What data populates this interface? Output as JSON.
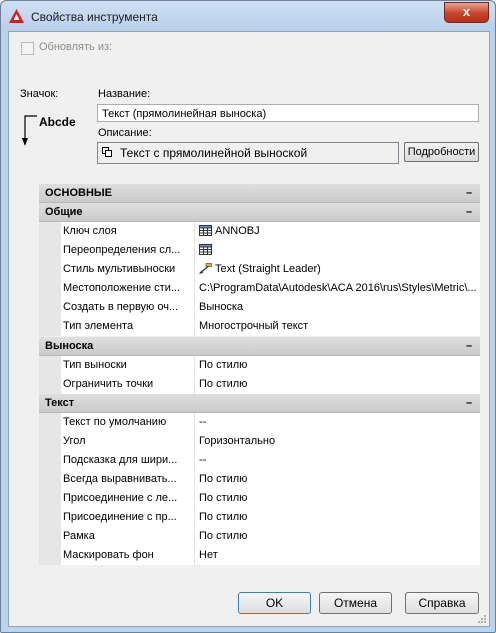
{
  "window": {
    "title": "Свойства инструмента",
    "close_label": "x"
  },
  "top": {
    "refresh_from_label": "Обновлять из:",
    "icon_label": "Значок:",
    "name_label": "Название:",
    "name_value": "Текст (прямолинейная выноска)",
    "description_label": "Описание:",
    "description_value": "Текст с прямолинейной выноской",
    "details_button": "Подробности",
    "preview_text": "Abcde"
  },
  "grid": {
    "main_header": "ОСНОВНЫЕ",
    "groups": {
      "general": {
        "title": "Общие",
        "rows": [
          {
            "name": "Ключ слоя",
            "value": "ANNOBJ",
            "icon": "table-icon"
          },
          {
            "name": "Переопределения сл...",
            "value": "",
            "icon": "table-icon"
          },
          {
            "name": "Стиль мультивыноски",
            "value": "Text (Straight Leader)",
            "icon": "leader-style-icon"
          },
          {
            "name": "Местоположение сти...",
            "value": "C:\\ProgramData\\Autodesk\\ACA 2016\\rus\\Styles\\Metric\\..."
          },
          {
            "name": "Создать в первую оч...",
            "value": "Выноска"
          },
          {
            "name": "Тип элемента",
            "value": "Многострочный текст"
          }
        ]
      },
      "leader": {
        "title": "Выноска",
        "rows": [
          {
            "name": "Тип выноски",
            "value": "По стилю"
          },
          {
            "name": "Ограничить точки",
            "value": "По стилю"
          }
        ]
      },
      "text": {
        "title": "Текст",
        "rows": [
          {
            "name": "Текст по умолчанию",
            "value": "--"
          },
          {
            "name": "Угол",
            "value": "Горизонтально"
          },
          {
            "name": "Подсказка для шири...",
            "value": "--"
          },
          {
            "name": "Всегда выравнивать...",
            "value": "По стилю"
          },
          {
            "name": "Присоединение с ле...",
            "value": "По стилю"
          },
          {
            "name": "Присоединение с пр...",
            "value": "По стилю"
          },
          {
            "name": "Рамка",
            "value": "По стилю"
          },
          {
            "name": "Маскировать фон",
            "value": "Нет"
          }
        ]
      }
    }
  },
  "buttons": {
    "ok": "OK",
    "cancel": "Отмена",
    "help": "Справка"
  },
  "colors": {
    "title_bar": "#bcd3ec",
    "close_button": "#c8442a",
    "band": "#d4d4d4"
  }
}
